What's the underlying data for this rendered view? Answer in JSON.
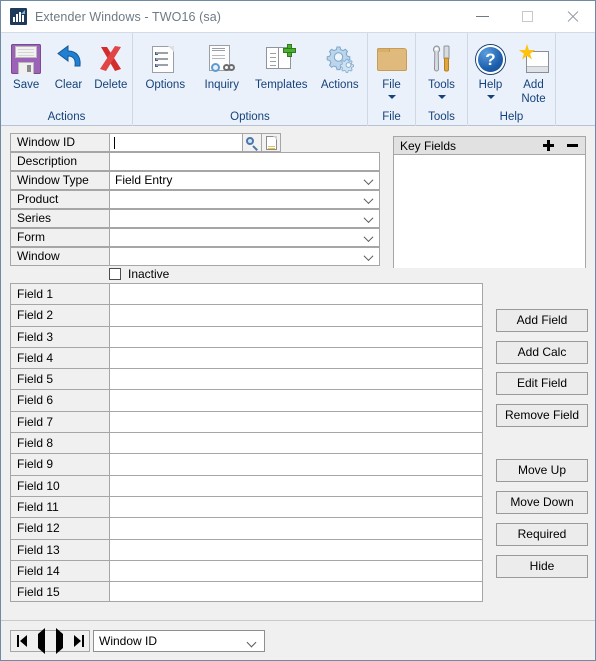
{
  "window": {
    "title": "Extender Windows  -  TWO16 (sa)",
    "app_icon": "chart-bars-icon",
    "minimize_label": "Minimize",
    "maximize_label": "Maximize",
    "close_label": "Close"
  },
  "ribbon": {
    "groups": [
      {
        "title": "Actions",
        "items": [
          {
            "label": "Save",
            "icon": "save-icon",
            "caret": false
          },
          {
            "label": "Clear",
            "icon": "undo-icon",
            "caret": false
          },
          {
            "label": "Delete",
            "icon": "delete-x-icon",
            "caret": false
          }
        ]
      },
      {
        "title": "Options",
        "items": [
          {
            "label": "Options",
            "icon": "document-list-icon",
            "caret": false
          },
          {
            "label": "Inquiry",
            "icon": "inquiry-icon",
            "caret": false
          },
          {
            "label": "Templates",
            "icon": "templates-icon",
            "caret": false
          },
          {
            "label": "Actions",
            "icon": "gears-icon",
            "caret": false
          }
        ]
      },
      {
        "title": "File",
        "items": [
          {
            "label": "File",
            "icon": "folder-icon",
            "caret": true
          }
        ]
      },
      {
        "title": "Tools",
        "items": [
          {
            "label": "Tools",
            "icon": "tools-icon",
            "caret": true
          }
        ]
      },
      {
        "title": "Help",
        "items": [
          {
            "label": "Help",
            "icon": "help-icon",
            "caret": true
          },
          {
            "label": "Add\nNote",
            "label_line1": "Add",
            "label_line2": "Note",
            "icon": "add-note-icon",
            "caret": false
          }
        ]
      }
    ]
  },
  "form": {
    "window_id": {
      "label": "Window ID",
      "value": "",
      "lookup_icon": "magnifier-icon",
      "note_icon": "note-icon"
    },
    "description": {
      "label": "Description",
      "value": ""
    },
    "window_type": {
      "label": "Window Type",
      "value": "Field Entry"
    },
    "product": {
      "label": "Product",
      "value": ""
    },
    "series": {
      "label": "Series",
      "value": ""
    },
    "form_sel": {
      "label": "Form",
      "value": ""
    },
    "window_sel": {
      "label": "Window",
      "value": ""
    },
    "inactive": {
      "label": "Inactive",
      "checked": false
    }
  },
  "key_fields": {
    "title": "Key Fields",
    "add_icon": "plus-icon",
    "remove_icon": "minus-icon",
    "items": []
  },
  "field_grid": {
    "rows": [
      {
        "label": "Field 1",
        "value": ""
      },
      {
        "label": "Field 2",
        "value": ""
      },
      {
        "label": "Field 3",
        "value": ""
      },
      {
        "label": "Field 4",
        "value": ""
      },
      {
        "label": "Field 5",
        "value": ""
      },
      {
        "label": "Field 6",
        "value": ""
      },
      {
        "label": "Field 7",
        "value": ""
      },
      {
        "label": "Field 8",
        "value": ""
      },
      {
        "label": "Field 9",
        "value": ""
      },
      {
        "label": "Field 10",
        "value": ""
      },
      {
        "label": "Field 11",
        "value": ""
      },
      {
        "label": "Field 12",
        "value": ""
      },
      {
        "label": "Field 13",
        "value": ""
      },
      {
        "label": "Field 14",
        "value": ""
      },
      {
        "label": "Field 15",
        "value": ""
      }
    ]
  },
  "side_buttons": {
    "add_field": "Add Field",
    "add_calc": "Add Calc",
    "edit_field": "Edit Field",
    "remove_field": "Remove Field",
    "move_up": "Move Up",
    "move_down": "Move Down",
    "required": "Required",
    "hide": "Hide"
  },
  "nav": {
    "first_icon": "nav-first-icon",
    "prev_icon": "nav-prev-icon",
    "next_icon": "nav-next-icon",
    "last_icon": "nav-last-icon",
    "sort_value": "Window ID"
  },
  "colors": {
    "ribbon_bg": "#eaf1fa",
    "ribbon_text": "#15427a",
    "window_border": "#6f8ba4",
    "body_bg": "#f0f0f0",
    "title_text": "#6e7b85"
  }
}
